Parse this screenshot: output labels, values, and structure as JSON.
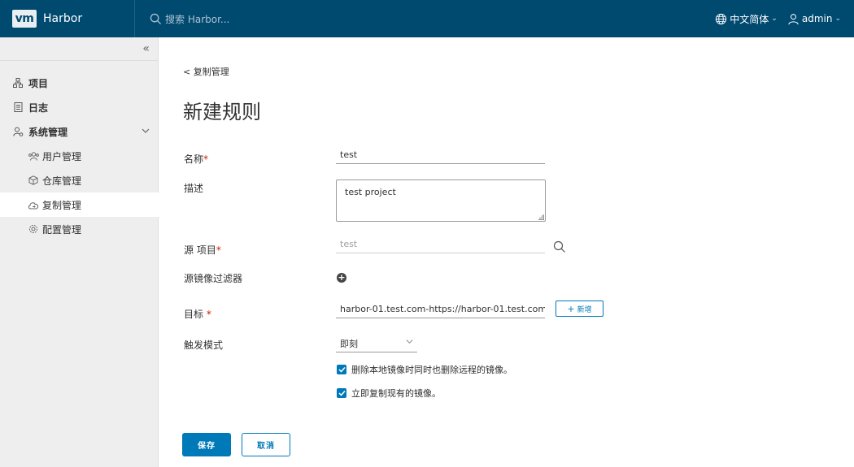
{
  "header": {
    "logo": "vm",
    "app_name": "Harbor",
    "search_placeholder": "搜索 Harbor...",
    "language": "中文简体",
    "user": "admin"
  },
  "sidebar": {
    "items": [
      {
        "label": "项目",
        "icon": "project-icon"
      },
      {
        "label": "日志",
        "icon": "log-icon"
      },
      {
        "label": "系统管理",
        "icon": "admin-icon"
      }
    ],
    "sub_items": [
      {
        "label": "用户管理",
        "icon": "users-icon"
      },
      {
        "label": "仓库管理",
        "icon": "registry-icon"
      },
      {
        "label": "复制管理",
        "icon": "cloud-replication-icon",
        "active": true
      },
      {
        "label": "配置管理",
        "icon": "gear-icon"
      }
    ]
  },
  "main": {
    "back_link": "< 复制管理",
    "title": "新建规则",
    "form": {
      "name_label": "名称",
      "name_value": "test",
      "desc_label": "描述",
      "desc_value": "test project",
      "source_label": "源 项目",
      "source_value": "test",
      "filter_label": "源镜像过滤器",
      "target_label": "目标",
      "target_value": "harbor-01.test.com-https://harbor-01.test.com",
      "new_button": "新增",
      "trigger_label": "触发模式",
      "trigger_value": "即刻",
      "check_delete": "删除本地镜像时同时也删除远程的镜像。",
      "check_replicate": "立即复制现有的镜像。",
      "required_mark": "*"
    },
    "save_button": "保存",
    "cancel_button": "取消"
  },
  "colors": {
    "header_bg": "#004a70",
    "accent": "#0079b8",
    "required": "#c92100",
    "sidebar_bg": "#eeeeee"
  }
}
